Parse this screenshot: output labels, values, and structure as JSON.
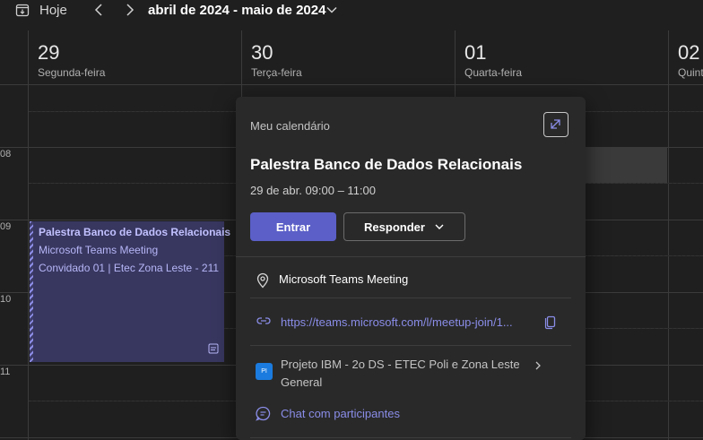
{
  "toolbar": {
    "today_label": "Hoje",
    "date_range": "abril de 2024 - maio de 2024"
  },
  "days": [
    {
      "num": "29",
      "name": "Segunda-feira"
    },
    {
      "num": "30",
      "name": "Terça-feira"
    },
    {
      "num": "01",
      "name": "Quarta-feira"
    },
    {
      "num": "02",
      "name": "Quinta-feira"
    }
  ],
  "hours": [
    "08",
    "09",
    "10",
    "11"
  ],
  "event": {
    "title": "Palestra Banco de Dados Relacionais",
    "line1": "Microsoft Teams Meeting",
    "line2": "Convidado 01 | Etec Zona Leste - 211"
  },
  "popup": {
    "calendar": "Meu calendário",
    "title": "Palestra Banco de Dados Relacionais",
    "time": "29 de abr. 09:00 – 11:00",
    "join_label": "Entrar",
    "respond_label": "Responder",
    "location": "Microsoft Teams Meeting",
    "link": "https://teams.microsoft.com/l/meetup-join/1...",
    "team_badge": "PI",
    "channel_team": "Projeto IBM - 2o DS - ETEC Poli e Zona Leste",
    "channel_name": "General",
    "chat_label": "Chat com participantes"
  },
  "colors": {
    "accent": "#5b5fc7",
    "event_bg": "#383760",
    "link": "#8a8de8"
  }
}
